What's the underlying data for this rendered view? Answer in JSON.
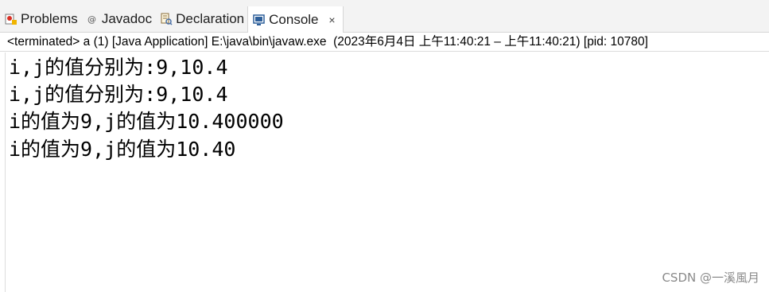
{
  "tabs": [
    {
      "label": "Problems",
      "icon": "problems-icon",
      "active": false
    },
    {
      "label": "Javadoc",
      "icon": "javadoc-icon",
      "active": false
    },
    {
      "label": "Declaration",
      "icon": "declaration-icon",
      "active": false
    },
    {
      "label": "Console",
      "icon": "console-icon",
      "active": true,
      "close": "×"
    }
  ],
  "status": "<terminated> a (1) [Java Application] E:\\java\\bin\\javaw.exe  (2023年6月4日 上午11:40:21 – 上午11:40:21) [pid: 10780]",
  "console_lines": [
    "i,j的值分别为:9,10.4",
    "i,j的值分别为:9,10.4",
    "i的值为9,j的值为10.400000",
    "i的值为9,j的值为10.40"
  ],
  "watermark": "CSDN @一溪風月"
}
